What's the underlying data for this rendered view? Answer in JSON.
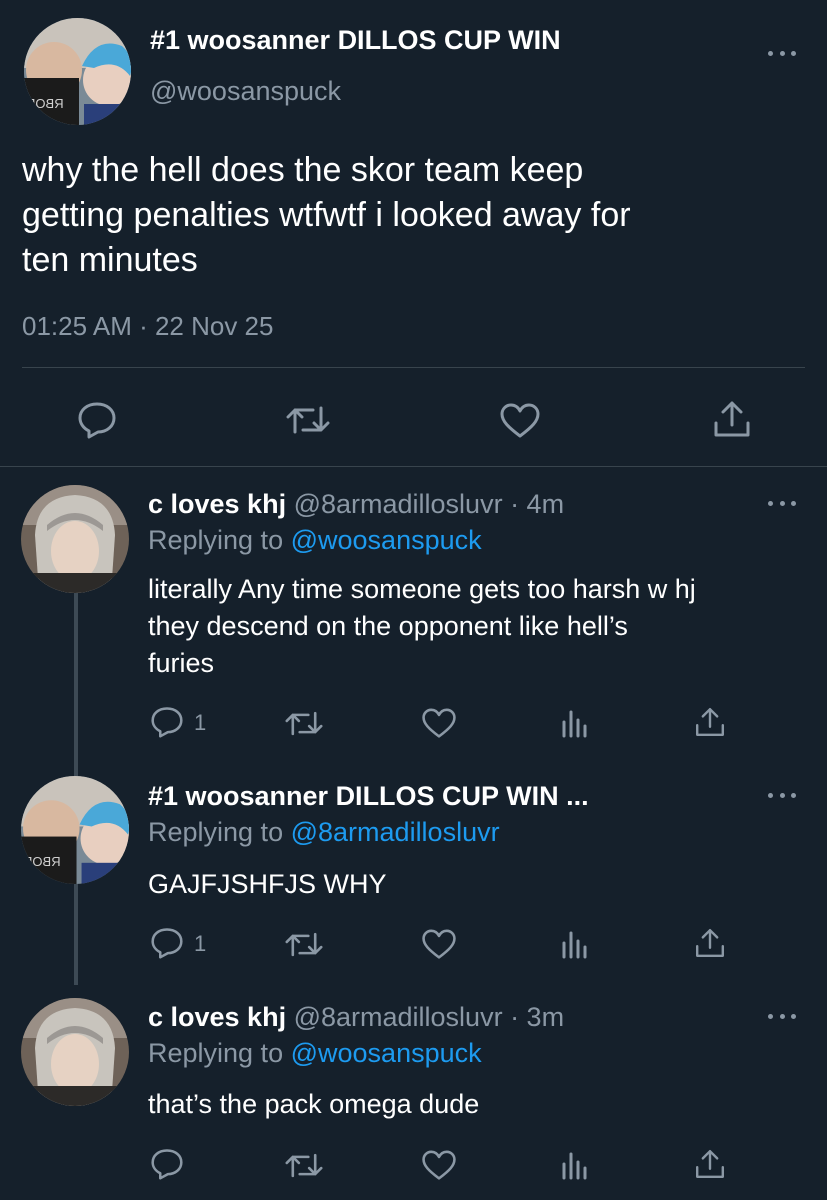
{
  "main_tweet": {
    "display_name": "#1 woosanner DILLOS CUP WIN",
    "handle": "@woosanspuck",
    "text_lines": [
      "why the hell does the skor team keep",
      "getting penalties wtfwtf i looked away for",
      "ten minutes"
    ],
    "timestamp": "01:25 AM · 22 Nov 25",
    "avatar_text": "RBOD"
  },
  "replies": [
    {
      "display_name": "c loves khj",
      "handle_time": "@8armadillosluvr · 4m",
      "replying_label": "Replying to",
      "replying_to": "@woosanspuck",
      "text_lines": [
        "literally Any time someone gets too harsh w hj",
        "they descend on the opponent like hell’s",
        "furies"
      ],
      "reply_count": "1"
    },
    {
      "display_name": "#1 woosanner DILLOS CUP WIN ...",
      "handle_time": "",
      "replying_label": "Replying to",
      "replying_to": "@8armadillosluvr",
      "text_lines": [
        "GAJFJSHFJS WHY"
      ],
      "reply_count": "1",
      "avatar_text": "RBOD"
    },
    {
      "display_name": "c loves khj",
      "handle_time": "@8armadillosluvr · 3m",
      "replying_label": "Replying to",
      "replying_to": "@woosanspuck",
      "text_lines": [
        "that’s the pack omega dude"
      ],
      "reply_count": ""
    }
  ],
  "icons": {
    "reply": "reply-icon",
    "retweet": "retweet-icon",
    "like": "heart-icon",
    "share": "share-icon",
    "analytics": "analytics-icon",
    "more": "more-icon"
  },
  "colors": {
    "background": "#15202b",
    "text": "#ffffff",
    "muted": "#8b98a5",
    "link": "#1d9bf0",
    "divider": "#38444d"
  }
}
